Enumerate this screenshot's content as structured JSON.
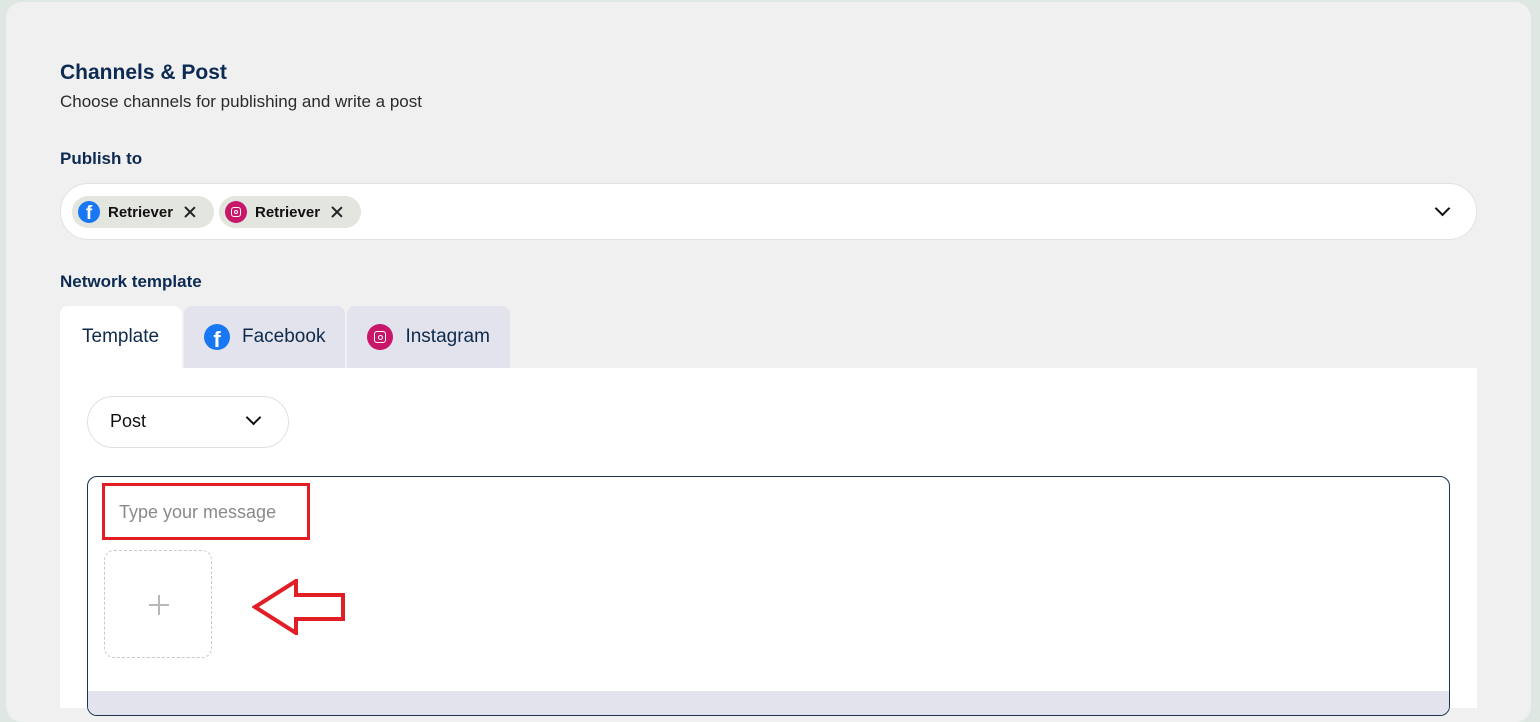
{
  "header": {
    "title": "Channels & Post",
    "subtitle": "Choose channels for publishing and write a post"
  },
  "publish": {
    "label": "Publish to",
    "chips": [
      {
        "network": "facebook",
        "icon": "facebook-icon",
        "label": "Retriever"
      },
      {
        "network": "instagram",
        "icon": "instagram-icon",
        "label": "Retriever"
      }
    ]
  },
  "network_template": {
    "label": "Network template",
    "tabs": [
      {
        "label": "Template",
        "active": true
      },
      {
        "label": "Facebook",
        "icon": "facebook-icon",
        "active": false
      },
      {
        "label": "Instagram",
        "icon": "instagram-icon",
        "active": false
      }
    ]
  },
  "post_type": {
    "value": "Post"
  },
  "editor": {
    "placeholder": "Type your message",
    "add_media_icon": "plus-icon"
  },
  "colors": {
    "facebook": "#1877f2",
    "instagram": "#c8176a",
    "annotation": "#e11e26",
    "heading": "#0d2a52"
  }
}
